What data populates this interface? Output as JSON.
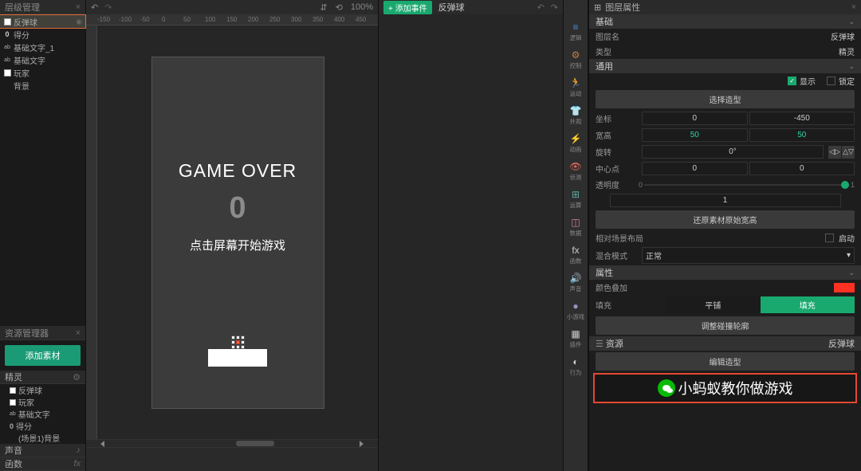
{
  "left": {
    "layers_title": "层级管理",
    "items": [
      {
        "label": "反弹球",
        "icon": "rect-white",
        "selected": true
      },
      {
        "label": "得分",
        "icon": "zero"
      },
      {
        "label": "基础文字_1",
        "icon": "text"
      },
      {
        "label": "基础文字",
        "icon": "text"
      },
      {
        "label": "玩家",
        "icon": "rect-white"
      },
      {
        "label": "背景",
        "icon": "none"
      }
    ],
    "res_title": "资源管理器",
    "add_asset": "添加素材",
    "sprite_group": "精灵",
    "sprites": [
      {
        "label": "反弹球",
        "icon": "rect-white"
      },
      {
        "label": "玩家",
        "icon": "rect-white"
      },
      {
        "label": "基础文字",
        "icon": "text"
      },
      {
        "label": "得分",
        "icon": "zero"
      },
      {
        "label": "(场景1)背景",
        "icon": "none"
      }
    ],
    "sound_group": "声音",
    "func_group": "函数"
  },
  "canvas": {
    "zoom": "100%",
    "ruler_ticks": [
      -150,
      -100,
      -50,
      0,
      50,
      100,
      150,
      200,
      250,
      300,
      350,
      400,
      450
    ],
    "game_over": "GAME OVER",
    "score": "0",
    "hint": "点击屏幕开始游戏"
  },
  "events": {
    "add": "+ 添加事件",
    "object": "反弹球"
  },
  "rail": [
    {
      "ico": "≡",
      "label": "逻辑",
      "color": "#4a8dd8"
    },
    {
      "ico": "⚙",
      "label": "控制",
      "color": "#c97f3a"
    },
    {
      "ico": "🏃",
      "label": "运动",
      "color": "#ccc"
    },
    {
      "ico": "👕",
      "label": "外观",
      "color": "#7fa9d8"
    },
    {
      "ico": "⚡",
      "label": "动画",
      "color": "#5fbf6d"
    },
    {
      "ico": "👁",
      "label": "侦测",
      "color": "#e86a5a"
    },
    {
      "ico": "⊞",
      "label": "运算",
      "color": "#5fa9a0"
    },
    {
      "ico": "◫",
      "label": "数据",
      "color": "#d87faa"
    },
    {
      "ico": "fx",
      "label": "函数",
      "color": "#ccc"
    },
    {
      "ico": "🔊",
      "label": "声音",
      "color": "#7f9fbf"
    },
    {
      "ico": "●",
      "label": "小游戏",
      "color": "#9f8fbf"
    },
    {
      "ico": "▦",
      "label": "插件",
      "color": "#ccc"
    },
    {
      "ico": "◐",
      "label": "行为",
      "color": "#ccc"
    }
  ],
  "props": {
    "title": "图层属性",
    "basic": "基础",
    "layer_name_label": "图层名",
    "layer_name": "反弹球",
    "type_label": "类型",
    "type": "精灵",
    "general": "通用",
    "show": "显示",
    "lock": "锁定",
    "select_shape": "选择造型",
    "coord_label": "坐标",
    "coord_x": "0",
    "coord_y": "-450",
    "size_label": "宽高",
    "size_w": "50",
    "size_h": "50",
    "rot_label": "旋转",
    "rot": "0°",
    "center_label": "中心点",
    "center_x": "0",
    "center_y": "0",
    "opacity_label": "透明度",
    "opacity_min": "0",
    "opacity_max": "1",
    "opacity_val": "1",
    "restore": "还原素材原始宽高",
    "rel_label": "相对场景布局",
    "enable": "启动",
    "blend_label": "混合模式",
    "blend": "正常",
    "attributes": "属性",
    "tint_label": "颜色叠加",
    "fill_label": "填充",
    "tile": "平铺",
    "fill": "填充",
    "collision": "调整碰撞轮廓",
    "resources": "资源",
    "resource_name": "反弹球",
    "edit_shape": "编辑造型",
    "wechat": "小蚂蚁教你做游戏"
  }
}
